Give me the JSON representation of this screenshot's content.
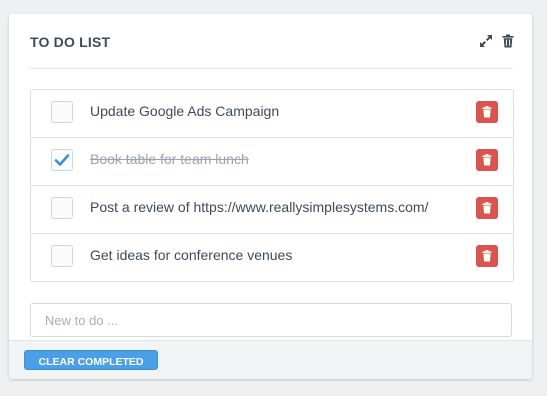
{
  "widget": {
    "title": "TO DO LIST",
    "expand_icon": "expand-icon",
    "delete_icon": "trash-icon"
  },
  "todos": [
    {
      "text": "Update Google Ads Campaign",
      "completed": false
    },
    {
      "text": "Book table for team lunch",
      "completed": true
    },
    {
      "text": "Post a review of https://www.reallysimplesystems.com/",
      "completed": false
    },
    {
      "text": "Get ideas for conference venues",
      "completed": false
    }
  ],
  "new_todo": {
    "value": "",
    "placeholder": "New to do ..."
  },
  "footer": {
    "clear_label": "CLEAR COMPLETED"
  },
  "colors": {
    "accent": "#4a9fe6",
    "danger": "#d9534f",
    "check": "#3b8fd8",
    "text": "#3d4b57"
  }
}
